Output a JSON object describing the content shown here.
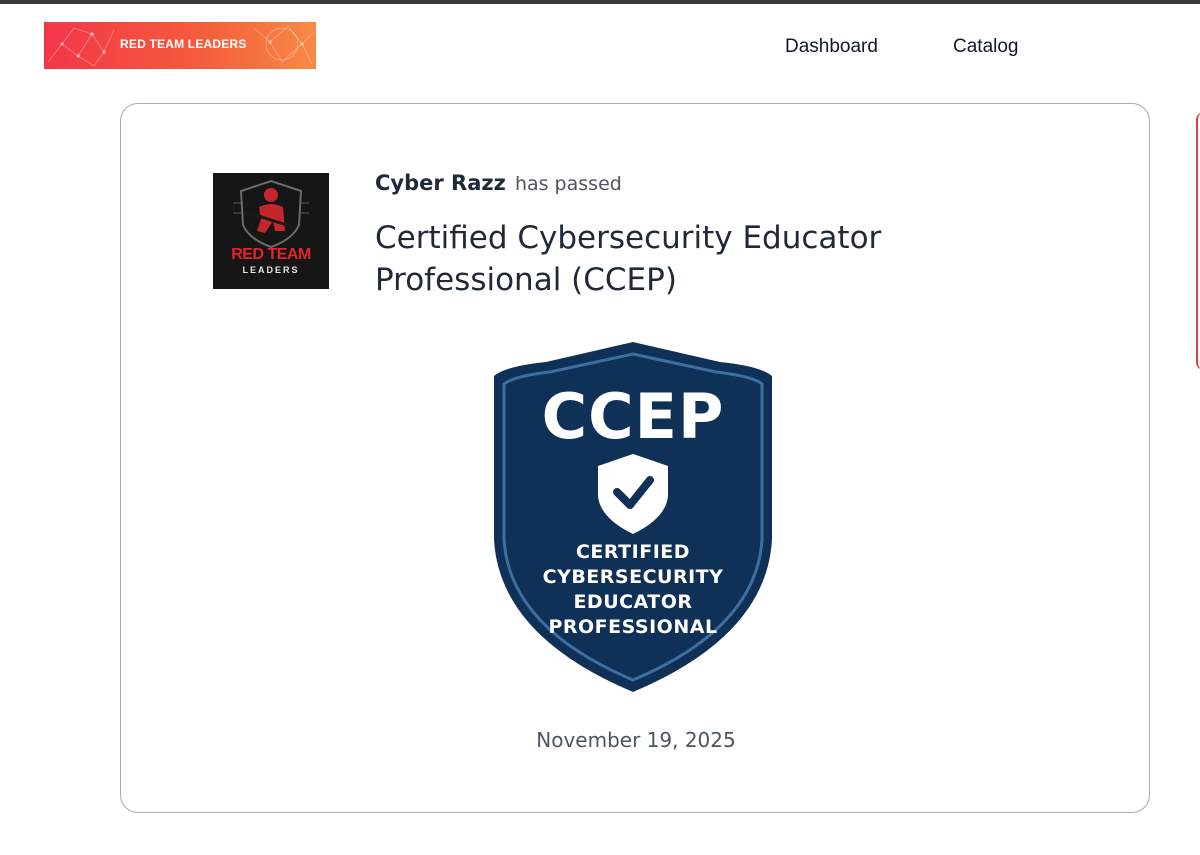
{
  "header": {
    "brand_label": "RED TEAM LEADERS",
    "nav": {
      "dashboard": "Dashboard",
      "catalog": "Catalog"
    }
  },
  "certificate": {
    "org_logo": {
      "line1": "RED TEAM",
      "line2": "LEADERS"
    },
    "recipient": "Cyber Razz",
    "status_text": "has passed",
    "title": "Certified Cybersecurity Educator Professional (CCEP)",
    "badge": {
      "abbreviation": "CCEP",
      "icon": "shield-check-icon",
      "lines": [
        "CERTIFIED",
        "CYBERSECURITY",
        "EDUCATOR",
        "PROFESSIONAL"
      ]
    },
    "date": "November 19, 2025"
  },
  "colors": {
    "brand_gradient_start": "#f2364a",
    "brand_gradient_end": "#f78a45",
    "badge_navy": "#0f3057",
    "badge_border": "#3e6f9e",
    "logo_red": "#e0262b"
  }
}
